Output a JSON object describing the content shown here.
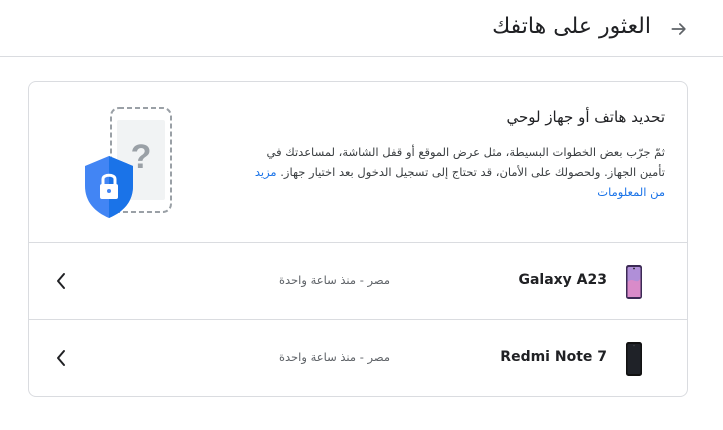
{
  "header": {
    "title": "العثور على هاتفك",
    "back_icon": "arrow-forward-icon"
  },
  "intro": {
    "title": "تحديد هاتف أو جهاز لوحي",
    "description": "ثمّ جرّب بعض الخطوات البسيطة، مثل عرض الموقع أو قفل الشاشة، لمساعدتك في تأمين الجهاز. ولحصولك على الأمان، قد تحتاج إلى تسجيل الدخول بعد اختيار جهاز.",
    "learn_more": "مزيد من المعلومات",
    "illustration_icons": [
      "phone-question-icon",
      "shield-lock-icon"
    ]
  },
  "devices": [
    {
      "name": "Galaxy A23",
      "meta": "مصر - منذ ساعة واحدة",
      "icon": "galaxy-phone-icon"
    },
    {
      "name": "Redmi Note 7",
      "meta": "مصر - منذ ساعة واحدة",
      "icon": "redmi-phone-icon"
    }
  ],
  "colors": {
    "accent": "#1a73e8",
    "shield": "#4285f4",
    "divider": "#dadce0"
  }
}
